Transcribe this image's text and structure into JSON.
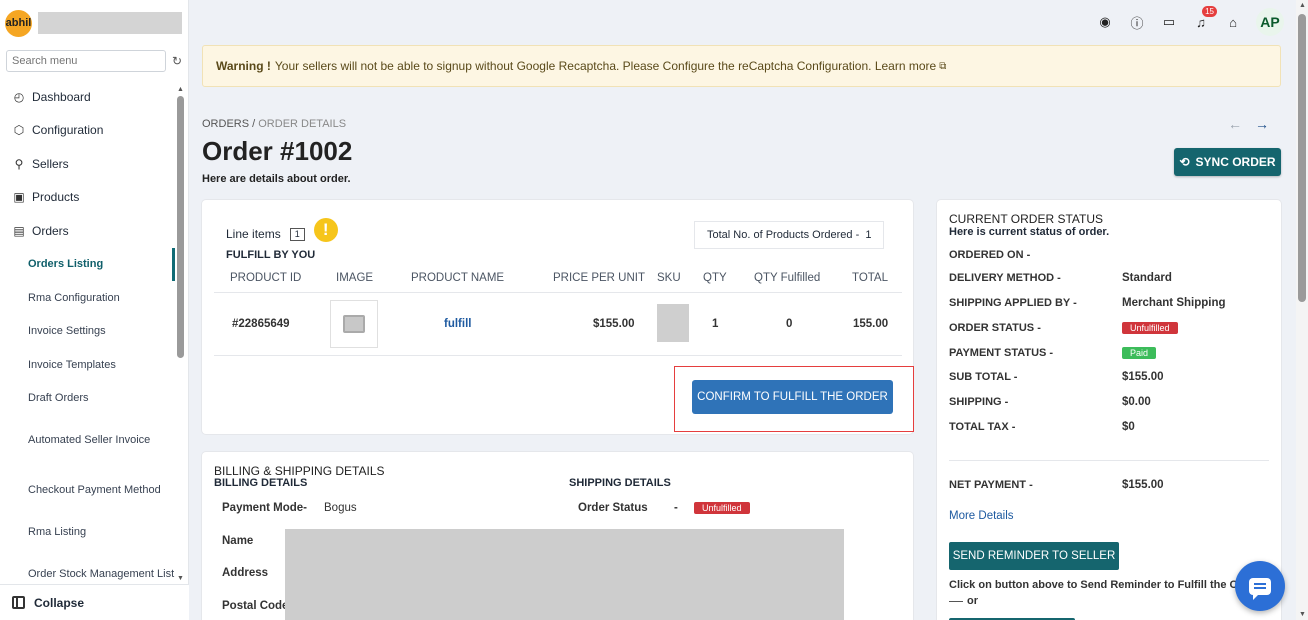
{
  "sidebar": {
    "logo_text": "abhil",
    "search_placeholder": "Search menu",
    "items": [
      {
        "label": "Dashboard",
        "icon": "dashboard-icon"
      },
      {
        "label": "Configuration",
        "icon": "gear-icon"
      },
      {
        "label": "Sellers",
        "icon": "user-icon"
      },
      {
        "label": "Products",
        "icon": "box-icon"
      },
      {
        "label": "Orders",
        "icon": "document-icon"
      }
    ],
    "sub_items": [
      "Orders Listing",
      "Rma Configuration",
      "Invoice Settings",
      "Invoice Templates",
      "Draft Orders",
      "Automated Seller Invoice",
      "Checkout Payment Method",
      "Rma Listing",
      "Order Stock Management List"
    ],
    "active_sub_item": "Orders Listing",
    "collapse_label": "Collapse"
  },
  "topbar": {
    "notifications_count": "15",
    "avatar_initials": "AP",
    "icons": [
      "account-icon",
      "help-icon",
      "feedback-icon",
      "bell-icon",
      "store-icon"
    ]
  },
  "warning": {
    "bold": "Warning !",
    "text": "Your sellers will not be able to signup without Google Recaptcha. Please Configure the reCaptcha Configuration.",
    "link": "Learn more"
  },
  "header": {
    "breadcrumb_root": "ORDERS",
    "breadcrumb_sep": "/",
    "breadcrumb_current": "ORDER DETAILS",
    "title": "Order #1002",
    "subtitle": "Here are details about order.",
    "sync_label": "SYNC ORDER"
  },
  "line_items": {
    "label": "Line items",
    "count": "1",
    "fulfill_by": "FULFILL BY YOU",
    "total_label": "Total No. of Products Ordered -",
    "total_value": "1",
    "columns": [
      "PRODUCT ID",
      "IMAGE",
      "PRODUCT NAME",
      "PRICE PER UNIT",
      "SKU",
      "QTY",
      "QTY Fulfilled",
      "TOTAL"
    ],
    "rows": [
      {
        "product_id": "#22865649",
        "product_name": "fulfill",
        "price": "$155.00",
        "qty": "1",
        "qty_fulfilled": "0",
        "total": "155.00"
      }
    ],
    "confirm_label": "CONFIRM TO FULFILL THE ORDER"
  },
  "billing": {
    "title": "BILLING & SHIPPING DETAILS",
    "billing_heading": "BILLING DETAILS",
    "shipping_heading": "SHIPPING DETAILS",
    "payment_mode_label": "Payment Mode-",
    "payment_mode_value": "Bogus",
    "order_status_label": "Order Status",
    "order_status_dash": "-",
    "order_status_value": "Unfulfilled",
    "name_label": "Name",
    "address_label": "Address",
    "postal_label": "Postal Code"
  },
  "status": {
    "title": "CURRENT ORDER STATUS",
    "subtitle": "Here is current status of order.",
    "ordered_on_label": "ORDERED ON -",
    "delivery_label": "DELIVERY METHOD -",
    "delivery_value": "Standard",
    "shipping_by_label": "SHIPPING APPLIED BY -",
    "shipping_by_value": "Merchant Shipping",
    "order_status_label": "ORDER STATUS -",
    "order_status_value": "Unfulfilled",
    "payment_status_label": "PAYMENT STATUS -",
    "payment_status_value": "Paid",
    "subtotal_label": "SUB TOTAL -",
    "subtotal_value": "$155.00",
    "shipping_label": "SHIPPING -",
    "shipping_value": "$0.00",
    "tax_label": "TOTAL TAX -",
    "tax_value": "$0",
    "net_label": "NET PAYMENT -",
    "net_value": "$155.00",
    "more_details": "More Details",
    "reminder_label": "SEND REMINDER TO SELLER",
    "reminder_note": "Click on button above to Send Reminder to Fulfill the Order",
    "or": "or"
  },
  "colors": {
    "teal": "#15656e",
    "blue": "#2f73b8",
    "red_tag": "#d0353b",
    "green_tag": "#3cbc5a",
    "warning_bg": "#fdf6e3"
  }
}
